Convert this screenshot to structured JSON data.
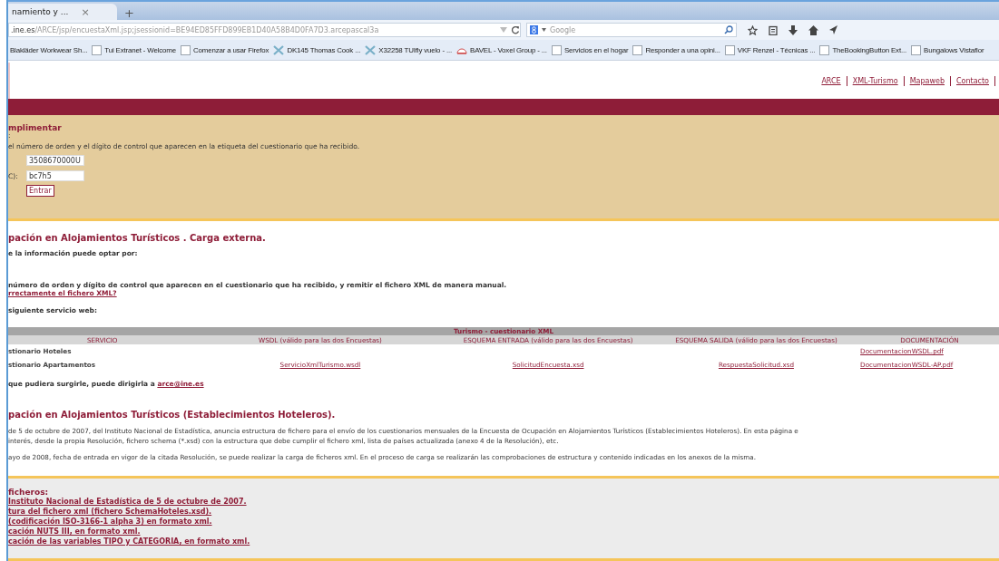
{
  "browser": {
    "tab": {
      "title": "namiento y ...",
      "close": "×"
    },
    "new_tab": "+",
    "url": {
      "host": ".ine.es",
      "path": "/ARCE/jsp/encuestaXml.jsp;jsessionid=BE94ED85FFD899EB1D40A58B4D0FA7D3.arcepascal3a"
    },
    "search": {
      "placeholder": "Google"
    },
    "bookmarks": [
      {
        "label": "Blakläder Workwear Sh...",
        "kind": "none"
      },
      {
        "label": "Tui Extranet - Welcome",
        "kind": "page"
      },
      {
        "label": "Comenzar a usar Firefox",
        "kind": "page"
      },
      {
        "label": "DK145 Thomas Cook ...",
        "kind": "plane"
      },
      {
        "label": "X32258 TUIfly vuelo - ...",
        "kind": "plane"
      },
      {
        "label": "BAVEL - Voxel Group - ...",
        "kind": "logo"
      },
      {
        "label": "Servicios en el hogar",
        "kind": "page"
      },
      {
        "label": "Responder a una opini...",
        "kind": "page"
      },
      {
        "label": "VKF Renzel - Técnicas ...",
        "kind": "page"
      },
      {
        "label": "TheBookingButton Ext...",
        "kind": "page"
      },
      {
        "label": "Bungalows Vistaflor",
        "kind": "page"
      }
    ]
  },
  "top_links": [
    "ARCE",
    "XML-Turismo",
    "Mapaweb",
    "Contacto"
  ],
  "form": {
    "title": "mplimentar",
    "note": ":",
    "instructions": "el número de orden y el dígito de control que aparecen en la etiqueta del cuestionario que ha recibido.",
    "fields": [
      {
        "value": "3508670000U"
      },
      {
        "label": "C):",
        "value": "bc7h5"
      }
    ],
    "button": "Entrar"
  },
  "carga": {
    "heading": "pación en Alojamientos Turísticos . Carga externa.",
    "intro": "e la información puede optar por:",
    "option": "número de orden y dígito de control que aparecen en el cuestionario que ha recibido, y remitir el fichero XML de manera manual.",
    "link": "rrectamente el fichero XML?",
    "service": "siguiente servicio web:"
  },
  "table": {
    "caption": "Turismo - cuestionario XML",
    "columns": [
      "SERVICIO",
      "WSDL (válido para las dos Encuestas)",
      "ESQUEMA ENTRADA (válido para las dos Encuestas)",
      "ESQUEMA SALIDA (válido para las dos Encuestas)",
      "DOCUMENTACIÓN"
    ],
    "rows": [
      {
        "servicio": "stionario Hoteles",
        "documentacion": "DocumentacionWSDL.pdf"
      },
      {
        "servicio": "stionario Apartamentos",
        "wsdl": "ServicioXmlTurismo.wsdl",
        "entrada": "SolicitudEncuesta.xsd",
        "salida": "RespuestaSolicitud.xsd",
        "documentacion": "DocumentacionWSDL-AP.pdf"
      }
    ]
  },
  "contact": {
    "text": "que pudiera surgirle, puede dirigirla a",
    "link": "arce@ine.es"
  },
  "hoteleros": {
    "heading": "pación en Alojamientos Turísticos (Establecimientos Hoteleros).",
    "lines": [
      "de 5 de octubre de 2007, del Instituto Nacional de Estadística, anuncia estructura de fichero para el envío de los cuestionarios mensuales de la Encuesta de Ocupación en Alojamientos Turísticos (Establecimientos Hoteleros). En esta página e",
      "interés, desde la propia Resolución, fichero schema (*.xsd) con la estructura que debe cumplir el fichero xml, lista de países actualizada (anexo 4 de la Resolución), etc."
    ],
    "para": "ayo de 2008, fecha de entrada en vigor de la citada Resolución, se puede realizar la carga de ficheros xml. En el proceso de carga se realizarán las comprobaciones de estructura y contenido indicadas en los anexos de la misma."
  },
  "files": {
    "title": "ficheros:",
    "links": [
      "Instituto Nacional de Estadística de 5 de octubre de 2007.",
      "tura del fichero xml (fichero SchemaHoteles.xsd).",
      "(codificación ISO-3166-1 alpha 3) en formato xml.",
      "cación NUTS III, en formato xml.",
      "cación de las variables TIPO y CATEGORIA, en formato xml."
    ]
  }
}
